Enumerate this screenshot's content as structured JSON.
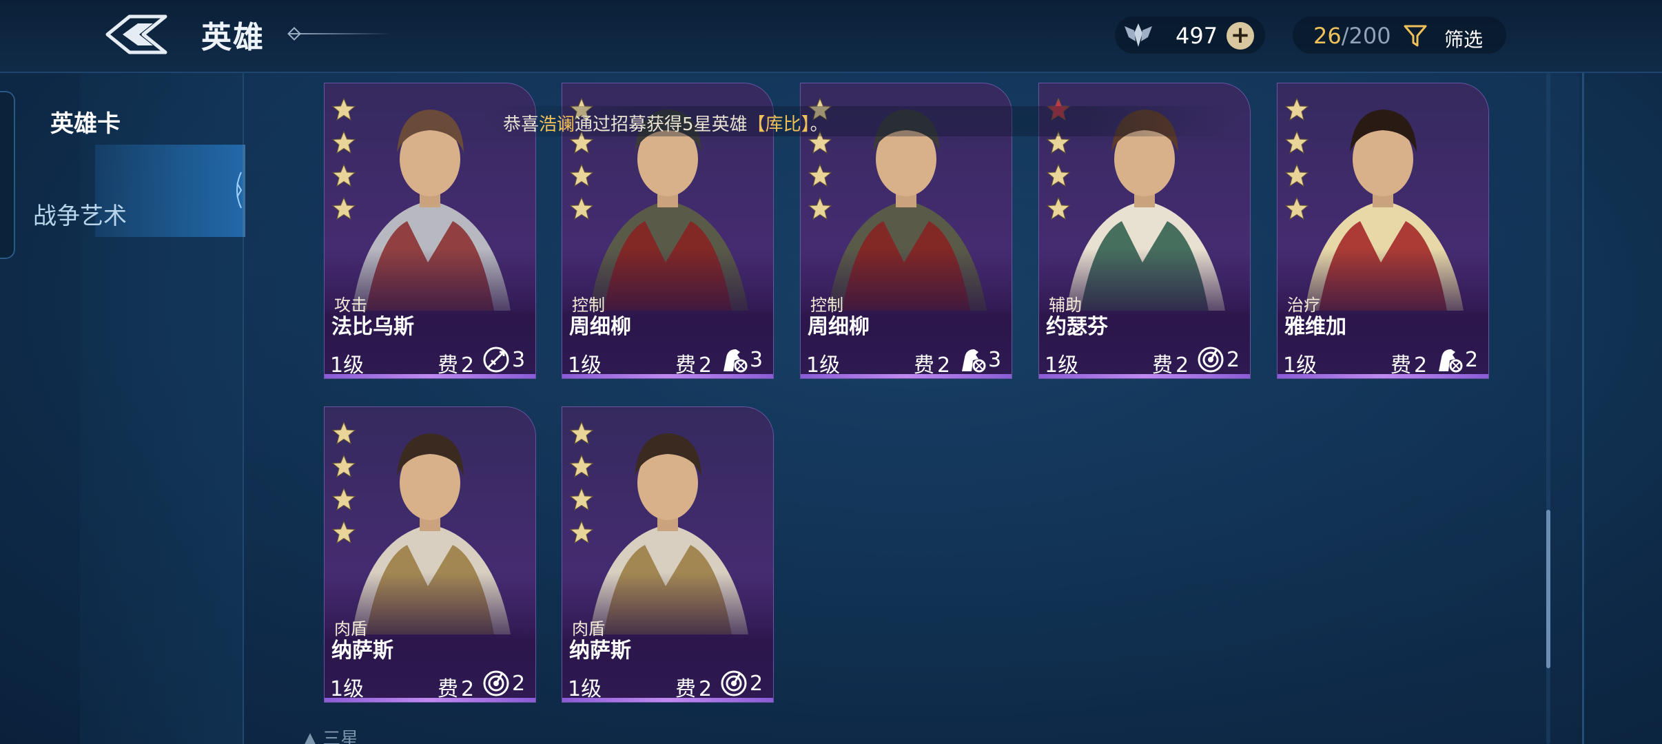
{
  "header": {
    "title": "英雄",
    "back_icon": "back-arrow-icon",
    "resource_icon": "crystal-wings-icon",
    "resource_value": "497",
    "plus_label": "+",
    "hero_count": "26",
    "hero_sep": "/",
    "hero_max": "200",
    "filter_icon": "funnel-icon",
    "filter_label": "筛选"
  },
  "sidebar": {
    "items": [
      {
        "label": "英雄卡",
        "active": true
      },
      {
        "label": "战争艺术",
        "active": false
      }
    ]
  },
  "notification": {
    "prefix": "恭喜",
    "player": "浩谰",
    "middle": "通过招募获得5星英雄",
    "open_bracket": "【",
    "hero": "库比",
    "close_bracket": "】",
    "suffix": "。"
  },
  "cards": [
    {
      "role": "攻击",
      "name": "法比乌斯",
      "level": "1级",
      "cost_label": "费",
      "cost": "2",
      "unit_icon": "archer-feather-icon",
      "unit_count": "3",
      "stars": 4,
      "red_stars": 0
    },
    {
      "role": "控制",
      "name": "周细柳",
      "level": "1级",
      "cost_label": "费",
      "cost": "2",
      "unit_icon": "cavalry-horse-icon",
      "unit_count": "3",
      "stars": 4,
      "red_stars": 0
    },
    {
      "role": "控制",
      "name": "周细柳",
      "level": "1级",
      "cost_label": "费",
      "cost": "2",
      "unit_icon": "cavalry-horse-icon",
      "unit_count": "3",
      "stars": 4,
      "red_stars": 0
    },
    {
      "role": "辅助",
      "name": "约瑟芬",
      "level": "1级",
      "cost_label": "费",
      "cost": "2",
      "unit_icon": "target-icon",
      "unit_count": "2",
      "stars": 4,
      "red_stars": 1
    },
    {
      "role": "治疗",
      "name": "雅维加",
      "level": "1级",
      "cost_label": "费",
      "cost": "2",
      "unit_icon": "cavalry-horse-icon",
      "unit_count": "2",
      "stars": 4,
      "red_stars": 0
    },
    {
      "role": "肉盾",
      "name": "纳萨斯",
      "level": "1级",
      "cost_label": "费",
      "cost": "2",
      "unit_icon": "target-icon",
      "unit_count": "2",
      "stars": 4,
      "red_stars": 0
    },
    {
      "role": "肉盾",
      "name": "纳萨斯",
      "level": "1级",
      "cost_label": "费",
      "cost": "2",
      "unit_icon": "target-icon",
      "unit_count": "2",
      "stars": 4,
      "red_stars": 0
    }
  ],
  "footer": {
    "hint": "▲ 三星"
  },
  "colors": {
    "accent_gold": "#f0c15a",
    "card_purple": "#4a2f7a",
    "card_bar": "#c08af0",
    "nav_active": "#2268a8",
    "star_gold": "#e9d49a",
    "star_red": "#c0394a"
  }
}
